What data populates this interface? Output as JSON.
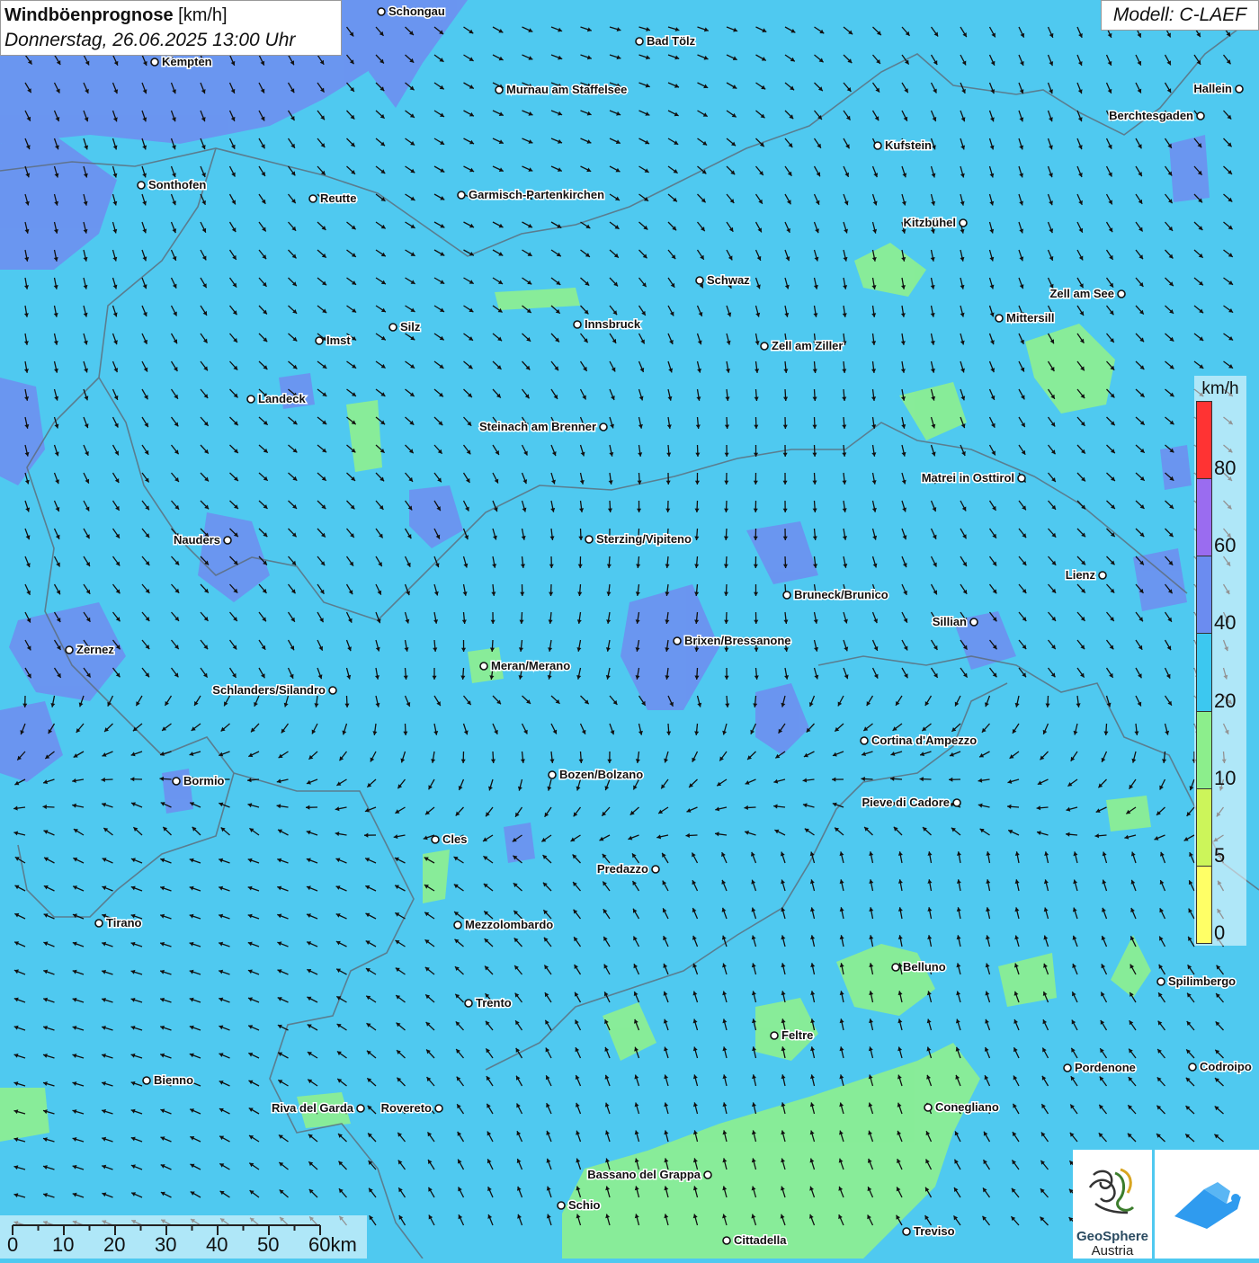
{
  "header": {
    "title_bold": "Windböenprognose",
    "title_unit": " [km/h]",
    "subtitle": "Donnerstag, 26.06.2025 13:00 Uhr",
    "model": "Modell: C-LAEF"
  },
  "legend": {
    "unit": "km/h",
    "classes": [
      {
        "from": 0,
        "to": 5,
        "color": "#ffff66"
      },
      {
        "from": 5,
        "to": 10,
        "color": "#ccf55a"
      },
      {
        "from": 10,
        "to": 20,
        "color": "#8cee8c"
      },
      {
        "from": 20,
        "to": 40,
        "color": "#3cc8f0"
      },
      {
        "from": 40,
        "to": 60,
        "color": "#6b8cf0"
      },
      {
        "from": 60,
        "to": 80,
        "color": "#9a6cf0"
      },
      {
        "from": 80,
        "to": 100,
        "color": "#ff3333"
      }
    ],
    "ticks": [
      "0",
      "5",
      "10",
      "20",
      "40",
      "60",
      "80"
    ]
  },
  "scalebar": {
    "labels": [
      "0",
      "10",
      "20",
      "30",
      "40",
      "50",
      "60km"
    ]
  },
  "logos": {
    "geosphere_line1": "GeoSphere",
    "geosphere_line2": "Austria"
  },
  "cities": [
    {
      "name": "Schongau",
      "label_side": "right"
    },
    {
      "name": "Bad Tölz",
      "label_side": "right"
    },
    {
      "name": "Kempten",
      "label_side": "right"
    },
    {
      "name": "Murnau am Staffelsee",
      "label_side": "right"
    },
    {
      "name": "Hallein",
      "label_side": "left"
    },
    {
      "name": "Berchtesgaden",
      "label_side": "left"
    },
    {
      "name": "Kufstein",
      "label_side": "right"
    },
    {
      "name": "Sonthofen",
      "label_side": "right"
    },
    {
      "name": "Reutte",
      "label_side": "right"
    },
    {
      "name": "Garmisch-Partenkirchen",
      "label_side": "right"
    },
    {
      "name": "Kitzbühel",
      "label_side": "left"
    },
    {
      "name": "Schwaz",
      "label_side": "right"
    },
    {
      "name": "Zell am See",
      "label_side": "left"
    },
    {
      "name": "Mittersill",
      "label_side": "right"
    },
    {
      "name": "Innsbruck",
      "label_side": "right"
    },
    {
      "name": "Silz",
      "label_side": "right"
    },
    {
      "name": "Imst",
      "label_side": "right"
    },
    {
      "name": "Zell am Ziller",
      "label_side": "right"
    },
    {
      "name": "Landeck",
      "label_side": "right"
    },
    {
      "name": "Steinach am Brenner",
      "label_side": "left"
    },
    {
      "name": "Matrei in Osttirol",
      "label_side": "left"
    },
    {
      "name": "Nauders",
      "label_side": "left"
    },
    {
      "name": "Sterzing/Vipiteno",
      "label_side": "right"
    },
    {
      "name": "Lienz",
      "label_side": "left"
    },
    {
      "name": "Bruneck/Brunico",
      "label_side": "right"
    },
    {
      "name": "Sillian",
      "label_side": "left"
    },
    {
      "name": "Brixen/Bressanone",
      "label_side": "right"
    },
    {
      "name": "Zernez",
      "label_side": "right"
    },
    {
      "name": "Meran/Merano",
      "label_side": "right"
    },
    {
      "name": "Schlanders/Silandro",
      "label_side": "left"
    },
    {
      "name": "Cortina d'Ampezzo",
      "label_side": "right"
    },
    {
      "name": "Bozen/Bolzano",
      "label_side": "right"
    },
    {
      "name": "Bormio",
      "label_side": "right"
    },
    {
      "name": "Pieve di Cadore",
      "label_side": "left"
    },
    {
      "name": "Cles",
      "label_side": "right"
    },
    {
      "name": "Predazzo",
      "label_side": "left"
    },
    {
      "name": "Tirano",
      "label_side": "right"
    },
    {
      "name": "Mezzolombardo",
      "label_side": "right"
    },
    {
      "name": "Belluno",
      "label_side": "right"
    },
    {
      "name": "Spilimbergo",
      "label_side": "right"
    },
    {
      "name": "Trento",
      "label_side": "right"
    },
    {
      "name": "Feltre",
      "label_side": "right"
    },
    {
      "name": "Bienno",
      "label_side": "right"
    },
    {
      "name": "Pordenone",
      "label_side": "right"
    },
    {
      "name": "Codroipo",
      "label_side": "right"
    },
    {
      "name": "Riva del Garda",
      "label_side": "left"
    },
    {
      "name": "Rovereto",
      "label_side": "left"
    },
    {
      "name": "Conegliano",
      "label_side": "right"
    },
    {
      "name": "Bassano del Grappa",
      "label_side": "left"
    },
    {
      "name": "Schio",
      "label_side": "right"
    },
    {
      "name": "Treviso",
      "label_side": "right"
    },
    {
      "name": "Cittadella",
      "label_side": "right"
    }
  ]
}
